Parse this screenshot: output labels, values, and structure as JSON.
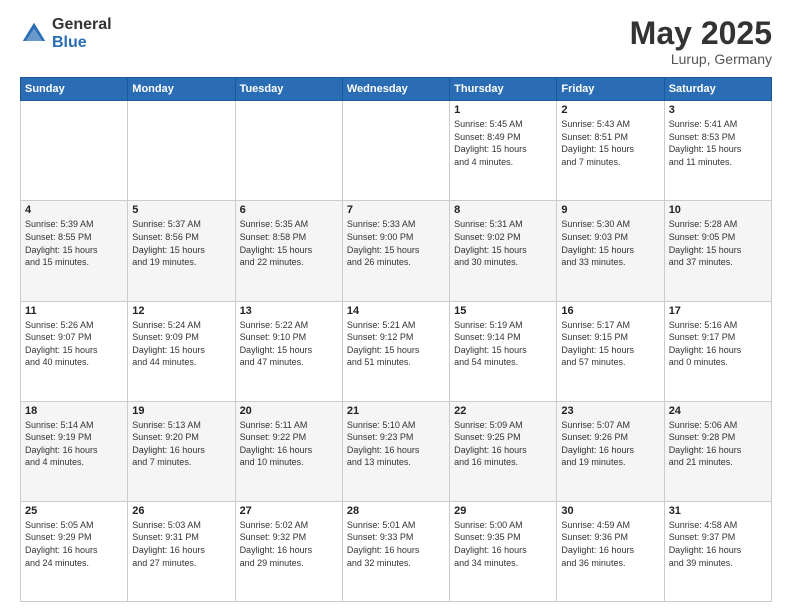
{
  "logo": {
    "general": "General",
    "blue": "Blue"
  },
  "header": {
    "month": "May 2025",
    "location": "Lurup, Germany"
  },
  "days_of_week": [
    "Sunday",
    "Monday",
    "Tuesday",
    "Wednesday",
    "Thursday",
    "Friday",
    "Saturday"
  ],
  "weeks": [
    [
      {
        "day": "",
        "info": ""
      },
      {
        "day": "",
        "info": ""
      },
      {
        "day": "",
        "info": ""
      },
      {
        "day": "",
        "info": ""
      },
      {
        "day": "1",
        "info": "Sunrise: 5:45 AM\nSunset: 8:49 PM\nDaylight: 15 hours\nand 4 minutes."
      },
      {
        "day": "2",
        "info": "Sunrise: 5:43 AM\nSunset: 8:51 PM\nDaylight: 15 hours\nand 7 minutes."
      },
      {
        "day": "3",
        "info": "Sunrise: 5:41 AM\nSunset: 8:53 PM\nDaylight: 15 hours\nand 11 minutes."
      }
    ],
    [
      {
        "day": "4",
        "info": "Sunrise: 5:39 AM\nSunset: 8:55 PM\nDaylight: 15 hours\nand 15 minutes."
      },
      {
        "day": "5",
        "info": "Sunrise: 5:37 AM\nSunset: 8:56 PM\nDaylight: 15 hours\nand 19 minutes."
      },
      {
        "day": "6",
        "info": "Sunrise: 5:35 AM\nSunset: 8:58 PM\nDaylight: 15 hours\nand 22 minutes."
      },
      {
        "day": "7",
        "info": "Sunrise: 5:33 AM\nSunset: 9:00 PM\nDaylight: 15 hours\nand 26 minutes."
      },
      {
        "day": "8",
        "info": "Sunrise: 5:31 AM\nSunset: 9:02 PM\nDaylight: 15 hours\nand 30 minutes."
      },
      {
        "day": "9",
        "info": "Sunrise: 5:30 AM\nSunset: 9:03 PM\nDaylight: 15 hours\nand 33 minutes."
      },
      {
        "day": "10",
        "info": "Sunrise: 5:28 AM\nSunset: 9:05 PM\nDaylight: 15 hours\nand 37 minutes."
      }
    ],
    [
      {
        "day": "11",
        "info": "Sunrise: 5:26 AM\nSunset: 9:07 PM\nDaylight: 15 hours\nand 40 minutes."
      },
      {
        "day": "12",
        "info": "Sunrise: 5:24 AM\nSunset: 9:09 PM\nDaylight: 15 hours\nand 44 minutes."
      },
      {
        "day": "13",
        "info": "Sunrise: 5:22 AM\nSunset: 9:10 PM\nDaylight: 15 hours\nand 47 minutes."
      },
      {
        "day": "14",
        "info": "Sunrise: 5:21 AM\nSunset: 9:12 PM\nDaylight: 15 hours\nand 51 minutes."
      },
      {
        "day": "15",
        "info": "Sunrise: 5:19 AM\nSunset: 9:14 PM\nDaylight: 15 hours\nand 54 minutes."
      },
      {
        "day": "16",
        "info": "Sunrise: 5:17 AM\nSunset: 9:15 PM\nDaylight: 15 hours\nand 57 minutes."
      },
      {
        "day": "17",
        "info": "Sunrise: 5:16 AM\nSunset: 9:17 PM\nDaylight: 16 hours\nand 0 minutes."
      }
    ],
    [
      {
        "day": "18",
        "info": "Sunrise: 5:14 AM\nSunset: 9:19 PM\nDaylight: 16 hours\nand 4 minutes."
      },
      {
        "day": "19",
        "info": "Sunrise: 5:13 AM\nSunset: 9:20 PM\nDaylight: 16 hours\nand 7 minutes."
      },
      {
        "day": "20",
        "info": "Sunrise: 5:11 AM\nSunset: 9:22 PM\nDaylight: 16 hours\nand 10 minutes."
      },
      {
        "day": "21",
        "info": "Sunrise: 5:10 AM\nSunset: 9:23 PM\nDaylight: 16 hours\nand 13 minutes."
      },
      {
        "day": "22",
        "info": "Sunrise: 5:09 AM\nSunset: 9:25 PM\nDaylight: 16 hours\nand 16 minutes."
      },
      {
        "day": "23",
        "info": "Sunrise: 5:07 AM\nSunset: 9:26 PM\nDaylight: 16 hours\nand 19 minutes."
      },
      {
        "day": "24",
        "info": "Sunrise: 5:06 AM\nSunset: 9:28 PM\nDaylight: 16 hours\nand 21 minutes."
      }
    ],
    [
      {
        "day": "25",
        "info": "Sunrise: 5:05 AM\nSunset: 9:29 PM\nDaylight: 16 hours\nand 24 minutes."
      },
      {
        "day": "26",
        "info": "Sunrise: 5:03 AM\nSunset: 9:31 PM\nDaylight: 16 hours\nand 27 minutes."
      },
      {
        "day": "27",
        "info": "Sunrise: 5:02 AM\nSunset: 9:32 PM\nDaylight: 16 hours\nand 29 minutes."
      },
      {
        "day": "28",
        "info": "Sunrise: 5:01 AM\nSunset: 9:33 PM\nDaylight: 16 hours\nand 32 minutes."
      },
      {
        "day": "29",
        "info": "Sunrise: 5:00 AM\nSunset: 9:35 PM\nDaylight: 16 hours\nand 34 minutes."
      },
      {
        "day": "30",
        "info": "Sunrise: 4:59 AM\nSunset: 9:36 PM\nDaylight: 16 hours\nand 36 minutes."
      },
      {
        "day": "31",
        "info": "Sunrise: 4:58 AM\nSunset: 9:37 PM\nDaylight: 16 hours\nand 39 minutes."
      }
    ]
  ]
}
